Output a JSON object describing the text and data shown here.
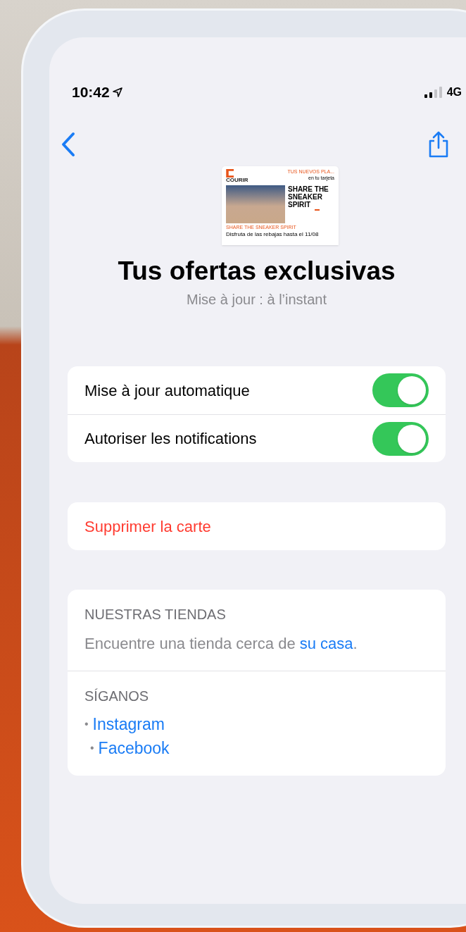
{
  "status_bar": {
    "time": "10:42",
    "network": "4G"
  },
  "pass": {
    "brand": "COURIR",
    "header_label": "TUS NUEVOS PLA...",
    "header_value": "en tu tarjeta",
    "headline": "SHARE THE SNEAKER SPIRIT",
    "secondary_label": "SHARE THE SNEAKER SPIRIT",
    "secondary_value": "Disfruta de las rebajas hasta el 11/08"
  },
  "title": "Tus ofertas exclusivas",
  "subtitle": "Mise à jour : à l’instant",
  "settings": [
    {
      "label": "Mise à jour automatique",
      "on": true
    },
    {
      "label": "Autoriser les notifications",
      "on": true
    }
  ],
  "delete_action": "Supprimer la carte",
  "stores": {
    "heading": "NUESTRAS TIENDAS",
    "text": "Encuentre una tienda cerca de",
    "link": "su casa",
    "end": "."
  },
  "follow": {
    "heading": "SÍGANOS",
    "bullet": "•",
    "links": [
      "Instagram",
      "Facebook"
    ]
  }
}
